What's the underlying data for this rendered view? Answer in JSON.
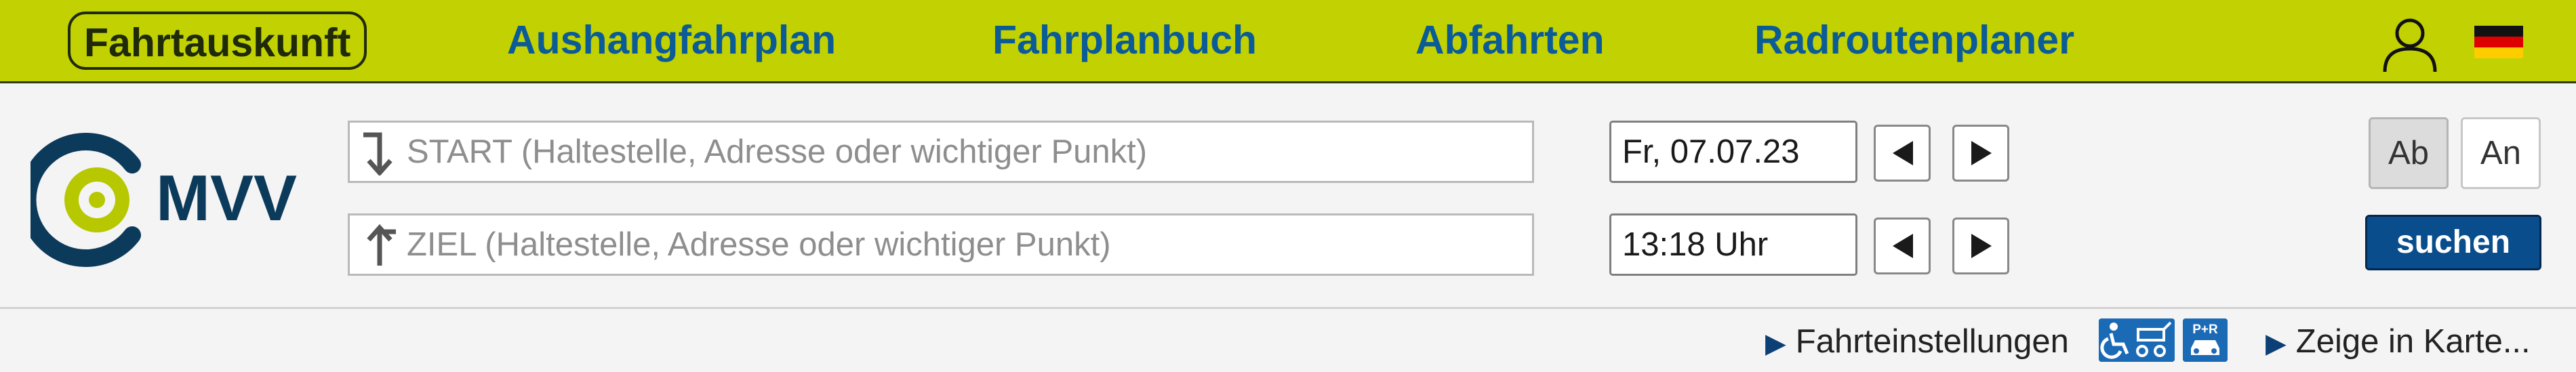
{
  "nav": {
    "items": [
      {
        "label": "Fahrtauskunft",
        "active": true
      },
      {
        "label": "Aushangfahrplan"
      },
      {
        "label": "Fahrplanbuch"
      },
      {
        "label": "Abfahrten"
      },
      {
        "label": "Radroutenplaner"
      }
    ],
    "user_icon": "user-icon",
    "language_icon": "german-flag-icon"
  },
  "logo": {
    "text": "MVV"
  },
  "search": {
    "start_placeholder": "START (Haltestelle, Adresse oder wichtiger Punkt)",
    "ziel_placeholder": "ZIEL (Haltestelle, Adresse oder wichtiger Punkt)",
    "date": "Fr, 07.07.23",
    "time": "13:18 Uhr",
    "mode_departure": "Ab",
    "mode_arrival": "An",
    "selected_mode": "Ab",
    "submit_label": "suchen"
  },
  "footer": {
    "settings_label": "Fahrteinstellungen",
    "map_label": "Zeige in Karte...",
    "arrow_glyph": "▶",
    "pr_badge_text": "P+R"
  },
  "colors": {
    "nav_bg": "#c2d101",
    "nav_link": "#0b5c96",
    "logo_dark": "#0c3a5b",
    "logo_green": "#b7c800",
    "button_blue": "#0a4d8c"
  }
}
